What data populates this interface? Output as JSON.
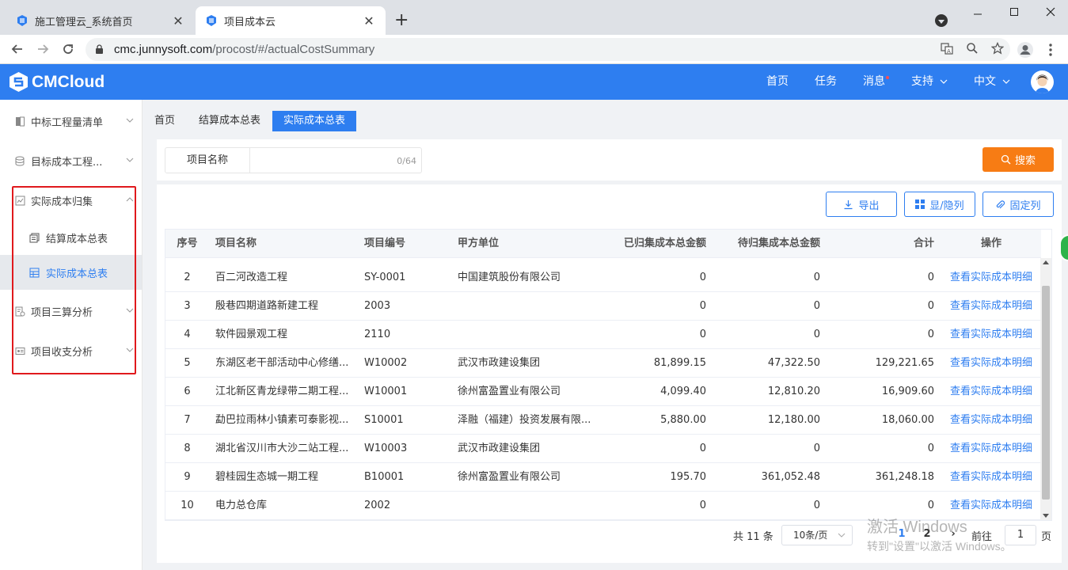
{
  "browser": {
    "tabs": [
      {
        "title": "施工管理云_系统首页",
        "close": "✕"
      },
      {
        "title": "项目成本云",
        "close": "✕"
      }
    ],
    "new_tab": "+",
    "url_host": "cmc.junnysoft.com",
    "url_path": "/procost/#/actualCostSummary"
  },
  "header": {
    "logo_text": "CMCloud",
    "nav": [
      {
        "label": "首页"
      },
      {
        "label": "任务"
      },
      {
        "label": "消息"
      },
      {
        "label": "支持"
      },
      {
        "label": "中文"
      }
    ],
    "brand_color": "#2e7ef0"
  },
  "sidebar": {
    "items": [
      {
        "label": "中标工程量清单"
      },
      {
        "label": "目标成本工程..."
      },
      {
        "label": "实际成本归集"
      },
      {
        "label": "项目三算分析"
      },
      {
        "label": "项目收支分析"
      }
    ],
    "subitems": [
      {
        "label": "结算成本总表"
      },
      {
        "label": "实际成本总表"
      }
    ]
  },
  "breadcrumbs": [
    {
      "label": "首页"
    },
    {
      "label": "结算成本总表"
    },
    {
      "label": "实际成本总表"
    }
  ],
  "search": {
    "label": "项目名称",
    "value": "",
    "count": "0/64",
    "button": "搜索",
    "button_color": "#f77c14"
  },
  "toolbar": {
    "export": "导出",
    "toggle_columns": "显/隐列",
    "fix_columns": "固定列"
  },
  "table": {
    "headers": [
      "序号",
      "项目名称",
      "项目编号",
      "甲方单位",
      "已归集成本总金额",
      "待归集成本总金额",
      "合计",
      "操作"
    ],
    "rows": [
      {
        "no": "2",
        "name": "百二河改造工程",
        "code": "SY-0001",
        "party": "中国建筑股份有限公司",
        "done": "0",
        "pend": "0",
        "sum": "0",
        "op": "查看实际成本明细"
      },
      {
        "no": "3",
        "name": "殷巷四期道路新建工程",
        "code": "2003",
        "party": "",
        "done": "0",
        "pend": "0",
        "sum": "0",
        "op": "查看实际成本明细"
      },
      {
        "no": "4",
        "name": "软件园景观工程",
        "code": "2110",
        "party": "",
        "done": "0",
        "pend": "0",
        "sum": "0",
        "op": "查看实际成本明细"
      },
      {
        "no": "5",
        "name": "东湖区老干部活动中心修缮...",
        "code": "W10002",
        "party": "武汉市政建设集团",
        "done": "81,899.15",
        "pend": "47,322.50",
        "sum": "129,221.65",
        "op": "查看实际成本明细"
      },
      {
        "no": "6",
        "name": "江北新区青龙绿带二期工程...",
        "code": "W10001",
        "party": "徐州富盈置业有限公司",
        "done": "4,099.40",
        "pend": "12,810.20",
        "sum": "16,909.60",
        "op": "查看实际成本明细"
      },
      {
        "no": "7",
        "name": "勐巴拉雨林小镇素可泰影视...",
        "code": "S10001",
        "party": "泽融（福建）投资发展有限...",
        "done": "5,880.00",
        "pend": "12,180.00",
        "sum": "18,060.00",
        "op": "查看实际成本明细"
      },
      {
        "no": "8",
        "name": "湖北省汉川市大沙二站工程...",
        "code": "W10003",
        "party": "武汉市政建设集团",
        "done": "0",
        "pend": "0",
        "sum": "0",
        "op": "查看实际成本明细"
      },
      {
        "no": "9",
        "name": "碧桂园生态城一期工程",
        "code": "B10001",
        "party": "徐州富盈置业有限公司",
        "done": "195.70",
        "pend": "361,052.48",
        "sum": "361,248.18",
        "op": "查看实际成本明细"
      },
      {
        "no": "10",
        "name": "电力总仓库",
        "code": "2002",
        "party": "",
        "done": "0",
        "pend": "0",
        "sum": "0",
        "op": "查看实际成本明细"
      }
    ]
  },
  "pagination": {
    "total": "共 11 条",
    "page_size": "10条/页",
    "pages": [
      "1",
      "2"
    ],
    "next": "›",
    "goto_label": "前往",
    "goto_value": "1",
    "goto_suffix": "页"
  },
  "watermark": {
    "line1": "激活 Windows",
    "line2": "转到\"设置\"以激活 Windows。"
  }
}
